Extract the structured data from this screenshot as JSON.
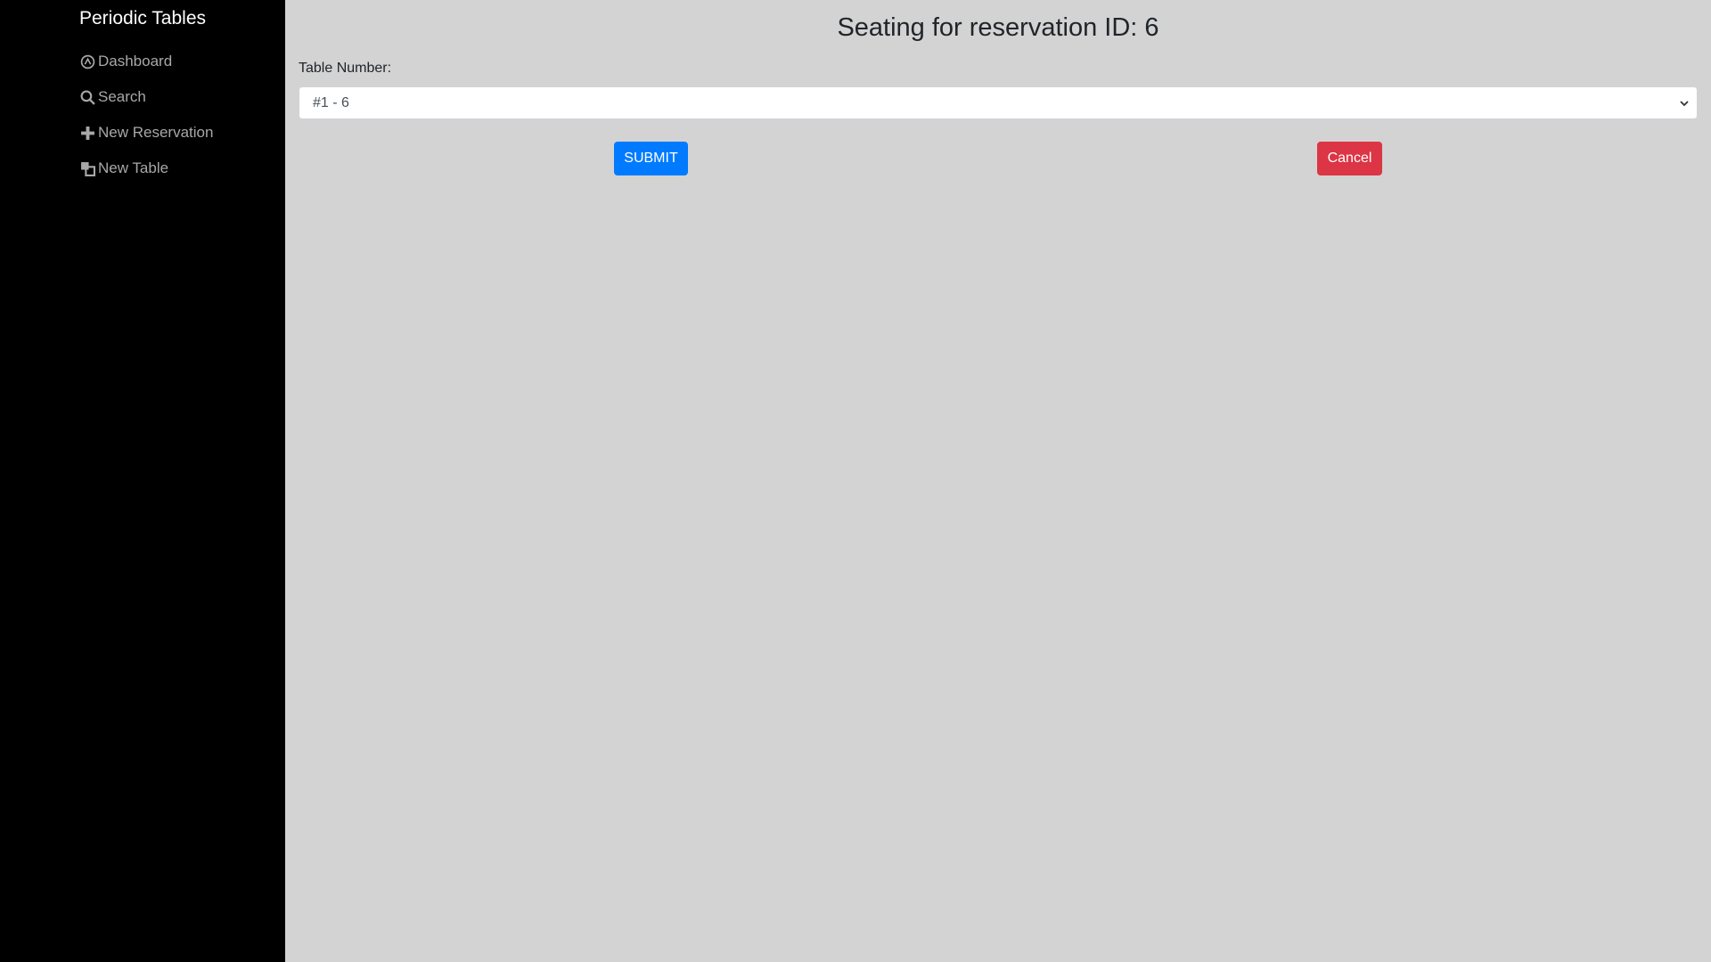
{
  "sidebar": {
    "brand": "Periodic Tables",
    "items": [
      {
        "label": "Dashboard",
        "icon": "dashboard-icon"
      },
      {
        "label": "Search",
        "icon": "search-icon"
      },
      {
        "label": "New Reservation",
        "icon": "plus-icon"
      },
      {
        "label": "New Table",
        "icon": "layers-icon"
      }
    ]
  },
  "main": {
    "title": "Seating for reservation ID: 6",
    "table_label": "Table Number:",
    "table_selected": "#1 - 6",
    "submit_label": "SUBMIT",
    "cancel_label": "Cancel"
  },
  "colors": {
    "sidebar_bg": "#000000",
    "main_bg": "#d3d3d3",
    "submit": "#007bff",
    "cancel": "#dc3545"
  }
}
